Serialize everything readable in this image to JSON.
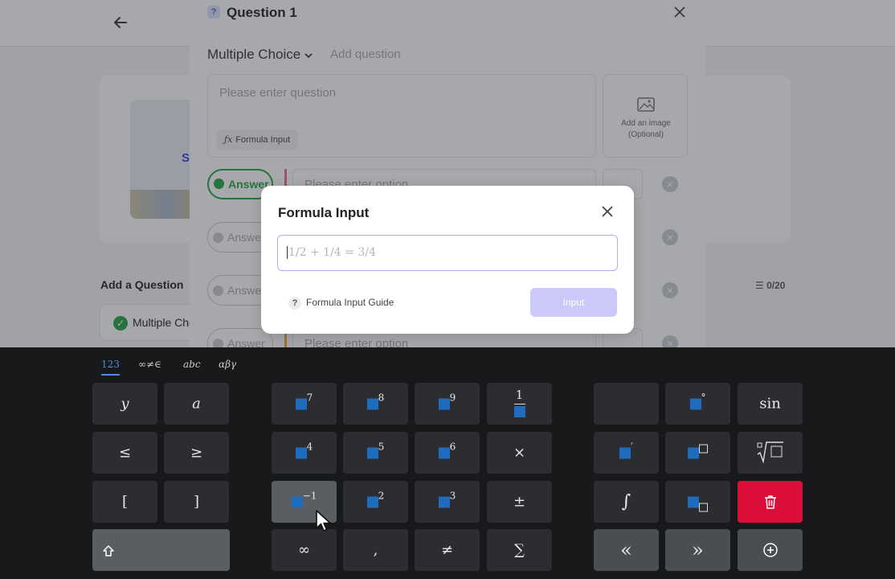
{
  "question_panel": {
    "title": "Question 1",
    "type": "Multiple Choice",
    "add_question": "Add question",
    "question_placeholder": "Please enter question",
    "formula_input_label": "Formula Input",
    "add_image_line1": "Add an image",
    "add_image_line2": "(Optional)",
    "answer_label": "Answer",
    "option_placeholder": "Please enter option"
  },
  "background": {
    "partial_text": "S",
    "add_a_question": "Add a Question",
    "count": "☰ 0/20",
    "multiple_choice_item": "Multiple Choice"
  },
  "dialog": {
    "title": "Formula Input",
    "placeholder": "1/2 + 1/4 = 3/4",
    "guide": "Formula Input Guide",
    "button": "Input"
  },
  "keyboard": {
    "tabs": [
      "123",
      "∞≠∈",
      "abc",
      "αβγ"
    ],
    "labels": {
      "y": "y",
      "a": "a",
      "le": "≤",
      "ge": "≥",
      "lbr": "[",
      "rbr": "]",
      "times": "×",
      "pm": "±",
      "infty": "∞",
      "comma": ",",
      "neq": "≠",
      "sum": "∑",
      "sin": "sin",
      "integral": "∫",
      "prev": "«",
      "next": "»",
      "exp7": "7",
      "exp8": "8",
      "exp9": "9",
      "exp4": "4",
      "exp5": "5",
      "exp6": "6",
      "exp_inv": "−1",
      "exp2": "2",
      "exp3": "3",
      "frac_num": "1",
      "degree": "°",
      "prime": "′"
    }
  },
  "colors": {
    "accent_green": "#22a447",
    "delete_red": "#dc0f3a",
    "input_button": "#cdc8fa",
    "box_blue": "#1f6cbf"
  }
}
